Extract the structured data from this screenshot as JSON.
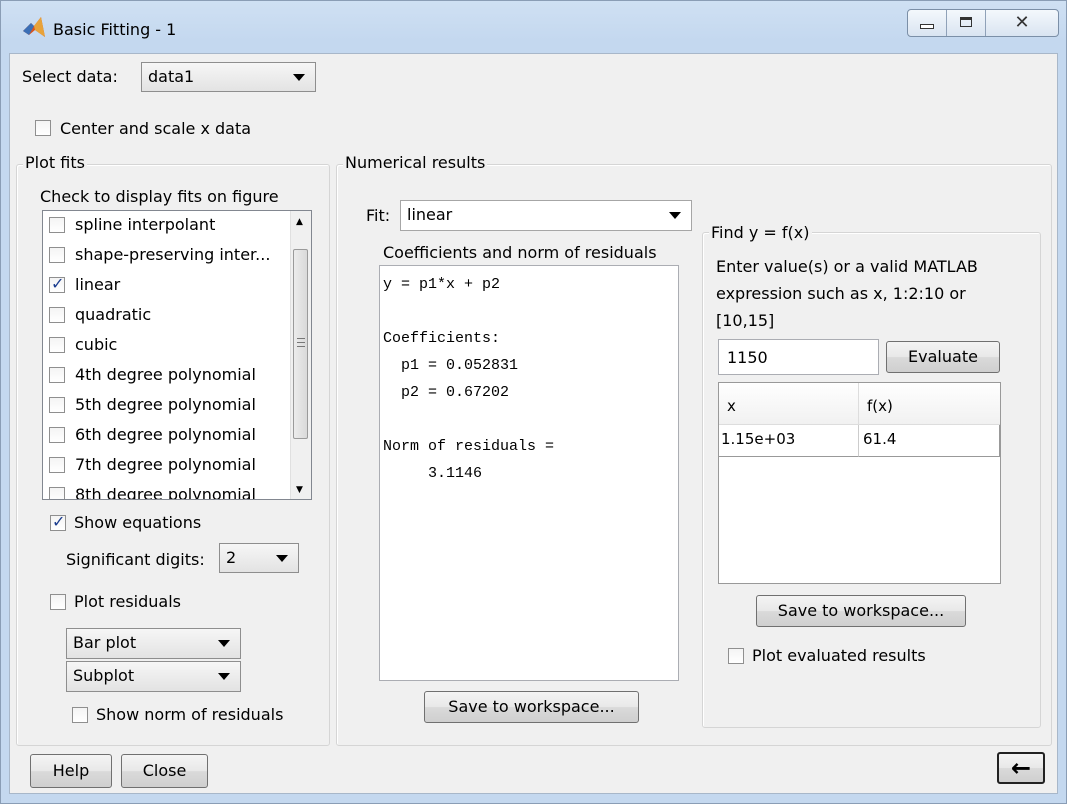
{
  "window": {
    "title": "Basic Fitting - 1",
    "controls": [
      "minimize",
      "maximize",
      "close"
    ]
  },
  "select_data": {
    "label": "Select data:",
    "value": "data1"
  },
  "center_scale": {
    "label": "Center and scale x data",
    "checked": false
  },
  "plot_fits": {
    "title": "Plot fits",
    "subtitle": "Check to display fits on figure",
    "items": [
      {
        "label": "spline interpolant",
        "checked": false
      },
      {
        "label": "shape-preserving inter...",
        "checked": false
      },
      {
        "label": "linear",
        "checked": true
      },
      {
        "label": "quadratic",
        "checked": false
      },
      {
        "label": "cubic",
        "checked": false
      },
      {
        "label": "4th degree polynomial",
        "checked": false
      },
      {
        "label": "5th degree polynomial",
        "checked": false
      },
      {
        "label": "6th degree polynomial",
        "checked": false
      },
      {
        "label": "7th degree polynomial",
        "checked": false
      },
      {
        "label": "8th degree polynomial",
        "checked": false
      }
    ],
    "show_equations": {
      "label": "Show equations",
      "checked": true
    },
    "significant_digits": {
      "label": "Significant digits:",
      "value": "2"
    },
    "plot_residuals": {
      "label": "Plot residuals",
      "checked": false
    },
    "residual_plot_type": "Bar plot",
    "residual_location": "Subplot",
    "show_norm": {
      "label": "Show norm of residuals",
      "checked": false
    }
  },
  "numerical_results": {
    "title": "Numerical results",
    "fit_label": "Fit:",
    "fit_value": "linear",
    "coef_title": "Coefficients and norm of residuals",
    "coef_lines": [
      "y = p1*x + p2",
      "",
      "Coefficients:",
      "  p1 = 0.052831",
      "  p2 = 0.67202",
      "",
      "Norm of residuals =",
      "     3.1146"
    ],
    "save_label": "Save to workspace..."
  },
  "find_y": {
    "title": "Find y = f(x)",
    "instructions": [
      "Enter value(s) or a valid MATLAB",
      "expression such as x, 1:2:10 or",
      "[10,15]"
    ],
    "input_value": "1150",
    "evaluate_label": "Evaluate",
    "table": {
      "headers": [
        "x",
        "f(x)"
      ],
      "rows": [
        [
          "1.15e+03",
          "61.4"
        ]
      ]
    },
    "save_label": "Save to workspace...",
    "plot_evaluated": {
      "label": "Plot evaluated results",
      "checked": false
    }
  },
  "footer": {
    "help_label": "Help",
    "close_label": "Close",
    "back_arrow": "←"
  }
}
